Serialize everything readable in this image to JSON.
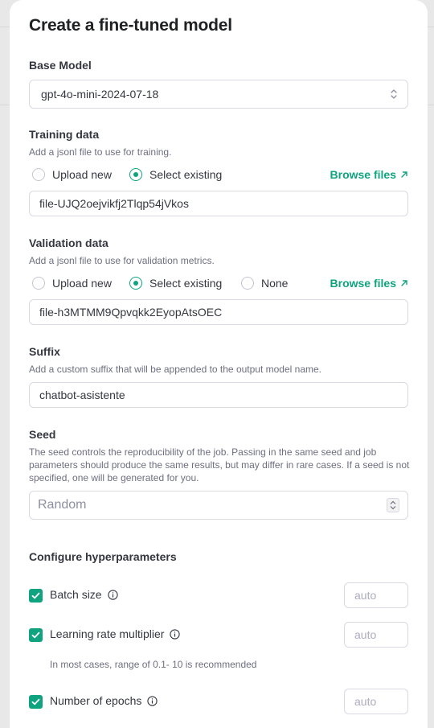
{
  "dialog": {
    "title": "Create a fine-tuned model"
  },
  "base_model": {
    "label": "Base Model",
    "value": "gpt-4o-mini-2024-07-18"
  },
  "training": {
    "label": "Training data",
    "help": "Add a jsonl file to use for training.",
    "options": [
      "Upload new",
      "Select existing"
    ],
    "selected": "Select existing",
    "browse_label": "Browse files",
    "file": "file-UJQ2oejvikfj2Tlqp54jVkos"
  },
  "validation": {
    "label": "Validation data",
    "help": "Add a jsonl file to use for validation metrics.",
    "options": [
      "Upload new",
      "Select existing",
      "None"
    ],
    "selected": "Select existing",
    "browse_label": "Browse files",
    "file": "file-h3MTMM9Qpvqkk2EyopAtsOEC"
  },
  "suffix": {
    "label": "Suffix",
    "help": "Add a custom suffix that will be appended to the output model name.",
    "value": "chatbot-asistente"
  },
  "seed": {
    "label": "Seed",
    "help_lines": [
      "The seed controls the reproducibility of the job. Passing in the same seed and job",
      "parameters should produce the same results, but may differ in rare cases. If a seed is not",
      "specified, one will be generated for you."
    ],
    "placeholder": "Random"
  },
  "hyperparameters": {
    "title": "Configure hyperparameters",
    "batch_size": {
      "label": "Batch size",
      "checked": true,
      "placeholder": "auto"
    },
    "learning_rate": {
      "label": "Learning rate multiplier",
      "checked": true,
      "placeholder": "auto",
      "hint": "In most cases, range of 0.1- 10 is recommended"
    },
    "epochs": {
      "label": "Number of epochs",
      "checked": true,
      "placeholder": "auto"
    }
  },
  "colors": {
    "accent": "#10a37f",
    "text": "#353740",
    "muted": "#6e6e80",
    "border": "#d9d9e3"
  }
}
